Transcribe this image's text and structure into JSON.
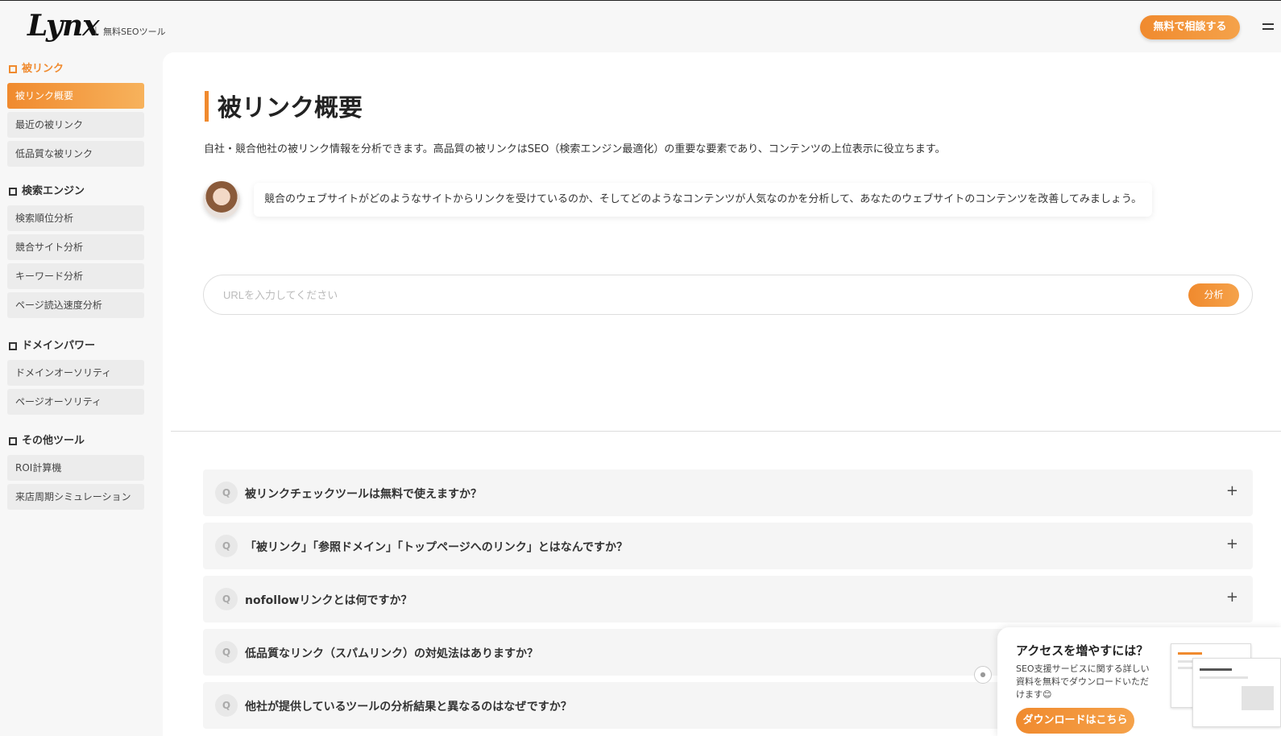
{
  "brand": {
    "logo": "Lynx",
    "separator": "|",
    "subtitle": "無料SEOツール"
  },
  "header": {
    "cta_label": "無料で相談する"
  },
  "sidebar": {
    "sections": [
      {
        "title": "被リンク",
        "items": [
          "被リンク概要",
          "最近の被リンク",
          "低品質な被リンク"
        ]
      },
      {
        "title": "検索エンジン",
        "items": [
          "検索順位分析",
          "競合サイト分析",
          "キーワード分析",
          "ページ読込速度分析"
        ]
      },
      {
        "title": "ドメインパワー",
        "items": [
          "ドメインオーソリティ",
          "ページオーソリティ"
        ]
      },
      {
        "title": "その他ツール",
        "items": [
          "ROI計算機",
          "来店周期シミュレーション"
        ]
      }
    ]
  },
  "main": {
    "title": "被リンク概要",
    "description": "自社・競合他社の被リンク情報を分析できます。高品質の被リンクはSEO（検索エンジン最適化）の重要な要素であり、コンテンツの上位表示に役立ちます。",
    "bubble_text": "競合のウェブサイトがどのようなサイトからリンクを受けているのか、そしてどのようなコンテンツが人気なのかを分析して、あなたのウェブサイトのコンテンツを改善してみましょう。",
    "search": {
      "placeholder": "URLを入力してください",
      "value": "",
      "button_label": "分析"
    }
  },
  "faq": {
    "q_label": "Q",
    "expand_icon": "+",
    "items": [
      "被リンクチェックツールは無料で使えますか？",
      "「被リンク」「参照ドメイン」「トップページへのリンク」とはなんですか？",
      "nofollowリンクとは何ですか？",
      "低品質なリンク（スパムリンク）の対処法はありますか？",
      "他社が提供しているツールの分析結果と異なるのはなぜですか？"
    ]
  },
  "popup": {
    "title": "アクセスを増やすには？",
    "text": "SEO支援サービスに関する詳しい資料を無料でダウンロードいただけます😊",
    "button_label": "ダウンロードはこちら"
  },
  "colors": {
    "accent": "#f08a2e",
    "background": "#f7f7f7",
    "panel": "#ffffff"
  }
}
